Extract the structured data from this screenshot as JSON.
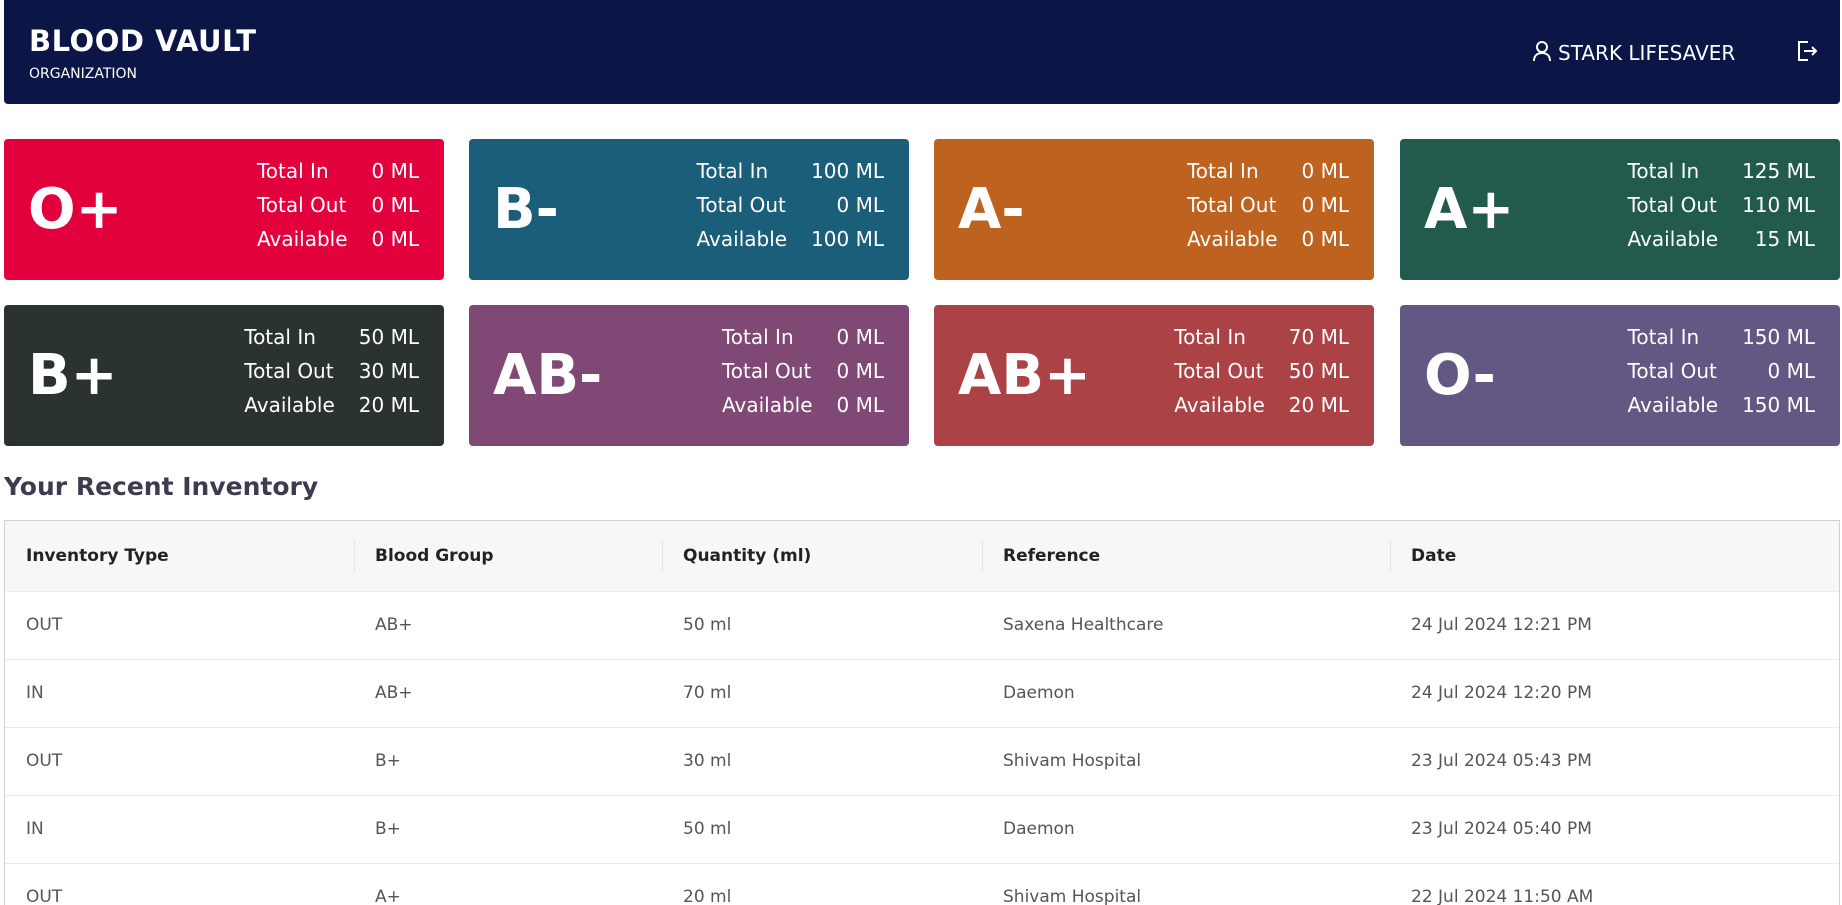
{
  "header": {
    "title": "BLOOD VAULT",
    "subtitle": "ORGANIZATION",
    "user_name": "STARK LIFESAVER",
    "colors": {
      "background": "#0b1546"
    }
  },
  "cards": [
    {
      "group": "O+",
      "color": "#e2013d",
      "total_in": "0 ML",
      "total_out": "0 ML",
      "available": "0 ML"
    },
    {
      "group": "B-",
      "color": "#1b5e7a",
      "total_in": "100 ML",
      "total_out": "0 ML",
      "available": "100 ML"
    },
    {
      "group": "A-",
      "color": "#bd621f",
      "total_in": "0 ML",
      "total_out": "0 ML",
      "available": "0 ML"
    },
    {
      "group": "A+",
      "color": "#235a4e",
      "total_in": "125 ML",
      "total_out": "110 ML",
      "available": "15 ML"
    },
    {
      "group": "B+",
      "color": "#2a3330",
      "total_in": "50 ML",
      "total_out": "30 ML",
      "available": "20 ML"
    },
    {
      "group": "AB-",
      "color": "#804874",
      "total_in": "0 ML",
      "total_out": "0 ML",
      "available": "0 ML"
    },
    {
      "group": "AB+",
      "color": "#ab4246",
      "total_in": "70 ML",
      "total_out": "50 ML",
      "available": "20 ML"
    },
    {
      "group": "O-",
      "color": "#635784",
      "total_in": "150 ML",
      "total_out": "0 ML",
      "available": "150 ML"
    }
  ],
  "card_labels": {
    "total_in": "Total In",
    "total_out": "Total Out",
    "available": "Available"
  },
  "section_title": "Your Recent Inventory",
  "table": {
    "columns": [
      "Inventory Type",
      "Blood Group",
      "Quantity (ml)",
      "Reference",
      "Date"
    ],
    "rows": [
      [
        "OUT",
        "AB+",
        "50 ml",
        "Saxena Healthcare",
        "24 Jul 2024 12:21 PM"
      ],
      [
        "IN",
        "AB+",
        "70 ml",
        "Daemon",
        "24 Jul 2024 12:20 PM"
      ],
      [
        "OUT",
        "B+",
        "30 ml",
        "Shivam Hospital",
        "23 Jul 2024 05:43 PM"
      ],
      [
        "IN",
        "B+",
        "50 ml",
        "Daemon",
        "23 Jul 2024 05:40 PM"
      ],
      [
        "OUT",
        "A+",
        "20 ml",
        "Shivam Hospital",
        "22 Jul 2024 11:50 AM"
      ]
    ]
  }
}
